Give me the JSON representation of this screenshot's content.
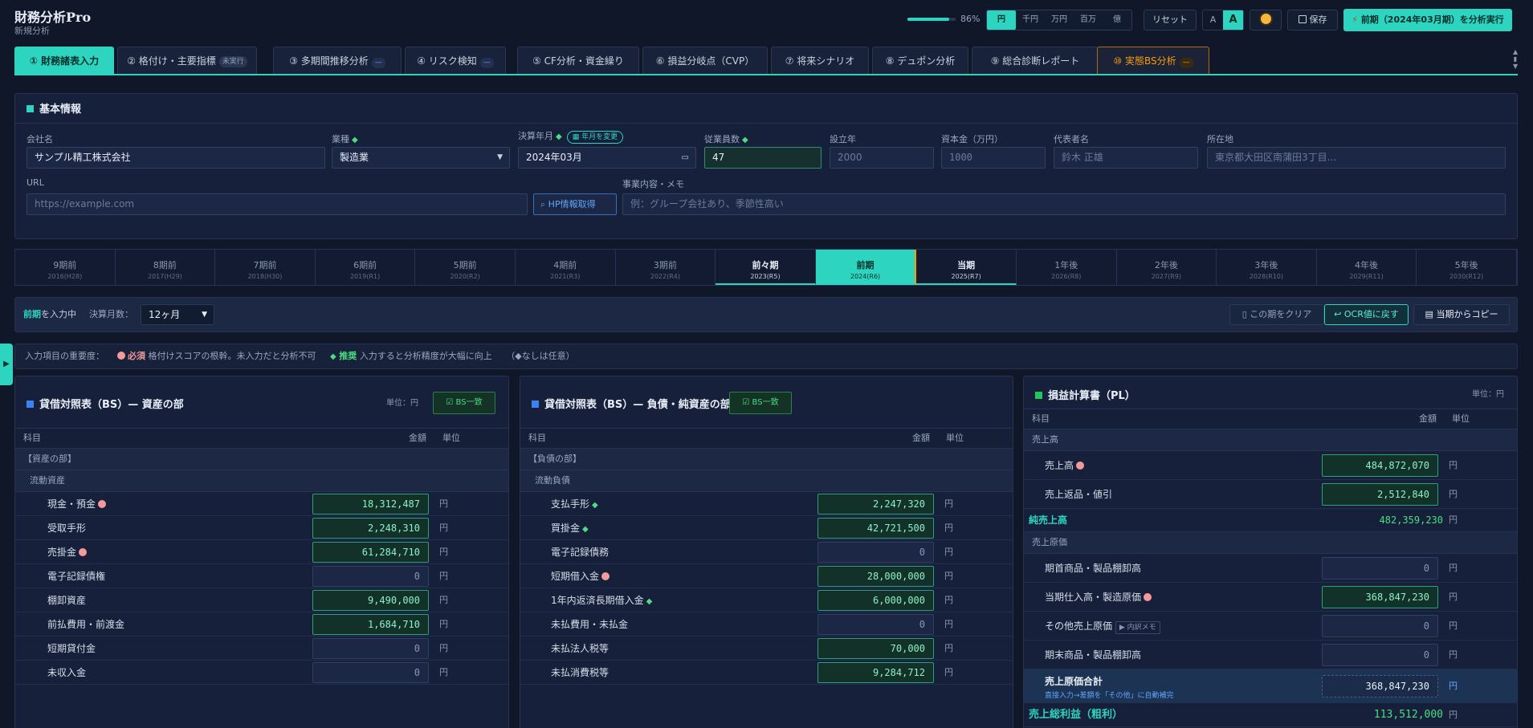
{
  "header": {
    "title": "財務分析Pro",
    "subtitle": "新規分析",
    "progress_percent": 86,
    "progress_label": "86%",
    "units": [
      "円",
      "千円",
      "万円",
      "百万",
      "億"
    ],
    "selected_unit": "円",
    "reset_label": "リセット",
    "font_small": "A",
    "font_large": "A",
    "theme_icon": "sun-icon",
    "save_label": "保存",
    "analyze_label": "前期（2024年03月期）を分析実行"
  },
  "tabs": [
    {
      "label": "① 財務諸表入力"
    },
    {
      "label": "② 格付け・主要指標",
      "badge": "未実行"
    },
    {
      "label": "③ 多期間推移分析",
      "badge": "—"
    },
    {
      "label": "④ リスク検知",
      "badge": "—"
    },
    {
      "label": "⑤ CF分析・資金繰り"
    },
    {
      "label": "⑥ 損益分岐点（CVP）"
    },
    {
      "label": "⑦ 将来シナリオ"
    },
    {
      "label": "⑧ デュポン分析"
    },
    {
      "label": "⑨ 総合診断レポート"
    },
    {
      "label": "⑩ 実態BS分析",
      "badge": "—"
    }
  ],
  "basic": {
    "title": "基本情報",
    "company_label": "会社名",
    "company_value": "サンプル精工株式会社",
    "industry_label": "業種",
    "industry_value": "製造業",
    "fiscal_label": "決算年月",
    "fiscal_badge": "年月を変更",
    "fiscal_value": "2024年03月",
    "employees_label": "従業員数",
    "employees_value": "47",
    "founded_label": "設立年",
    "founded_placeholder": "2000",
    "capital_label": "資本金（万円）",
    "capital_placeholder": "1000",
    "ceo_label": "代表者名",
    "ceo_placeholder": "鈴木 正雄",
    "address_label": "所在地",
    "address_placeholder": "東京都大田区南蒲田3丁目...",
    "url_label": "URL",
    "url_placeholder": "https://example.com",
    "hp_button": "HP情報取得",
    "memo_label": "事業内容・メモ",
    "memo_placeholder": "例：グループ会社あり、季節性高い"
  },
  "periods": [
    {
      "name": "9期前",
      "year": "2016(H28)"
    },
    {
      "name": "8期前",
      "year": "2017(H29)"
    },
    {
      "name": "7期前",
      "year": "2018(H30)"
    },
    {
      "name": "6期前",
      "year": "2019(R1)"
    },
    {
      "name": "5期前",
      "year": "2020(R2)"
    },
    {
      "name": "4期前",
      "year": "2021(R3)"
    },
    {
      "name": "3期前",
      "year": "2022(R4)"
    },
    {
      "name": "前々期",
      "year": "2023(R5)"
    },
    {
      "name": "前期",
      "year": "2024(R6)"
    },
    {
      "name": "当期",
      "year": "2025(R7)"
    },
    {
      "name": "1年後",
      "year": "2026(R8)"
    },
    {
      "name": "2年後",
      "year": "2027(R9)"
    },
    {
      "name": "3年後",
      "year": "2028(R10)"
    },
    {
      "name": "4年後",
      "year": "2029(R11)"
    },
    {
      "name": "5年後",
      "year": "2030(R12)"
    }
  ],
  "input_bar": {
    "current": "前期",
    "current_suffix": "を入力中",
    "months_label": "決算月数：",
    "months_value": "12ヶ月",
    "clear_label": "この期をクリア",
    "ocr_label": "OCR値に戻す",
    "copy_label": "当期からコピー"
  },
  "legend": {
    "title": "入力項目の重要度：",
    "required": "必須",
    "required_desc": "格付けスコアの根幹。未入力だと分析不可",
    "recommended": "推奨",
    "recommended_desc": "入力すると分析精度が大幅に向上",
    "optional_note": "（◆なしは任意）"
  },
  "assets": {
    "title": "貸借対照表（BS）— 資産の部",
    "unit_label": "単位：円",
    "bs_ok": "BS一致",
    "col_item": "科目",
    "col_amount": "金額",
    "col_unit": "単位",
    "group1": "【資産の部】",
    "group2": "流動資産",
    "rows": [
      {
        "name": "現金・預金",
        "mark": "req",
        "value": "18,312,487",
        "filled": true
      },
      {
        "name": "受取手形",
        "mark": "",
        "value": "2,248,310",
        "filled": true
      },
      {
        "name": "売掛金",
        "mark": "req",
        "value": "61,284,710",
        "filled": true
      },
      {
        "name": "電子記録債権",
        "mark": "",
        "value": "0",
        "filled": false
      },
      {
        "name": "棚卸資産",
        "mark": "",
        "value": "9,490,000",
        "filled": true
      },
      {
        "name": "前払費用・前渡金",
        "mark": "",
        "value": "1,684,710",
        "filled": true
      },
      {
        "name": "短期貸付金",
        "mark": "",
        "value": "0",
        "filled": false
      },
      {
        "name": "未収入金",
        "mark": "",
        "value": "0",
        "filled": false
      }
    ],
    "unit": "円"
  },
  "liabilities": {
    "title": "貸借対照表（BS）— 負債・純資産の部",
    "bs_ok": "BS一致",
    "col_item": "科目",
    "col_amount": "金額",
    "col_unit": "単位",
    "group1": "【負債の部】",
    "group2": "流動負債",
    "rows": [
      {
        "name": "支払手形",
        "mark": "rec",
        "value": "2,247,320",
        "filled": true
      },
      {
        "name": "買掛金",
        "mark": "rec",
        "value": "42,721,500",
        "filled": true
      },
      {
        "name": "電子記録債務",
        "mark": "",
        "value": "0",
        "filled": false
      },
      {
        "name": "短期借入金",
        "mark": "req",
        "value": "28,000,000",
        "filled": true
      },
      {
        "name": "1年内返済長期借入金",
        "mark": "rec",
        "value": "6,000,000",
        "filled": true
      },
      {
        "name": "未払費用・未払金",
        "mark": "",
        "value": "0",
        "filled": false
      },
      {
        "name": "未払法人税等",
        "mark": "",
        "value": "70,000",
        "filled": true
      },
      {
        "name": "未払消費税等",
        "mark": "",
        "value": "9,284,712",
        "filled": true
      }
    ],
    "unit": "円"
  },
  "pl": {
    "title": "損益計算書（PL）",
    "unit_label": "単位：円",
    "col_item": "科目",
    "col_amount": "金額",
    "col_unit": "単位",
    "group_sales": "売上高",
    "sales": "売上高",
    "sales_value": "484,872,070",
    "returns": "売上返品・値引",
    "returns_value": "2,512,840",
    "net_sales": "純売上高",
    "net_sales_value": "482,359,230",
    "group_cogs": "売上原価",
    "begin_inv": "期首商品・製品棚卸高",
    "begin_inv_value": "0",
    "purchases": "当期仕入高・製造原価",
    "purchases_value": "368,847,230",
    "other_cogs": "その他売上原価",
    "other_cogs_memo": "▶ 内訳メモ",
    "other_cogs_value": "0",
    "end_inv": "期末商品・製品棚卸高",
    "end_inv_value": "0",
    "cogs_total": "売上原価合計",
    "cogs_note": "直接入力→差額を「その他」に自動補完",
    "cogs_total_value": "368,847,230",
    "gross": "売上総利益（粗利）",
    "gross_value": "113,512,000",
    "unit": "円"
  },
  "colors": {
    "accent": "#2dd4bf",
    "orange": "#f59e0b",
    "required": "#f49a9a",
    "recommended": "#4ade80"
  }
}
